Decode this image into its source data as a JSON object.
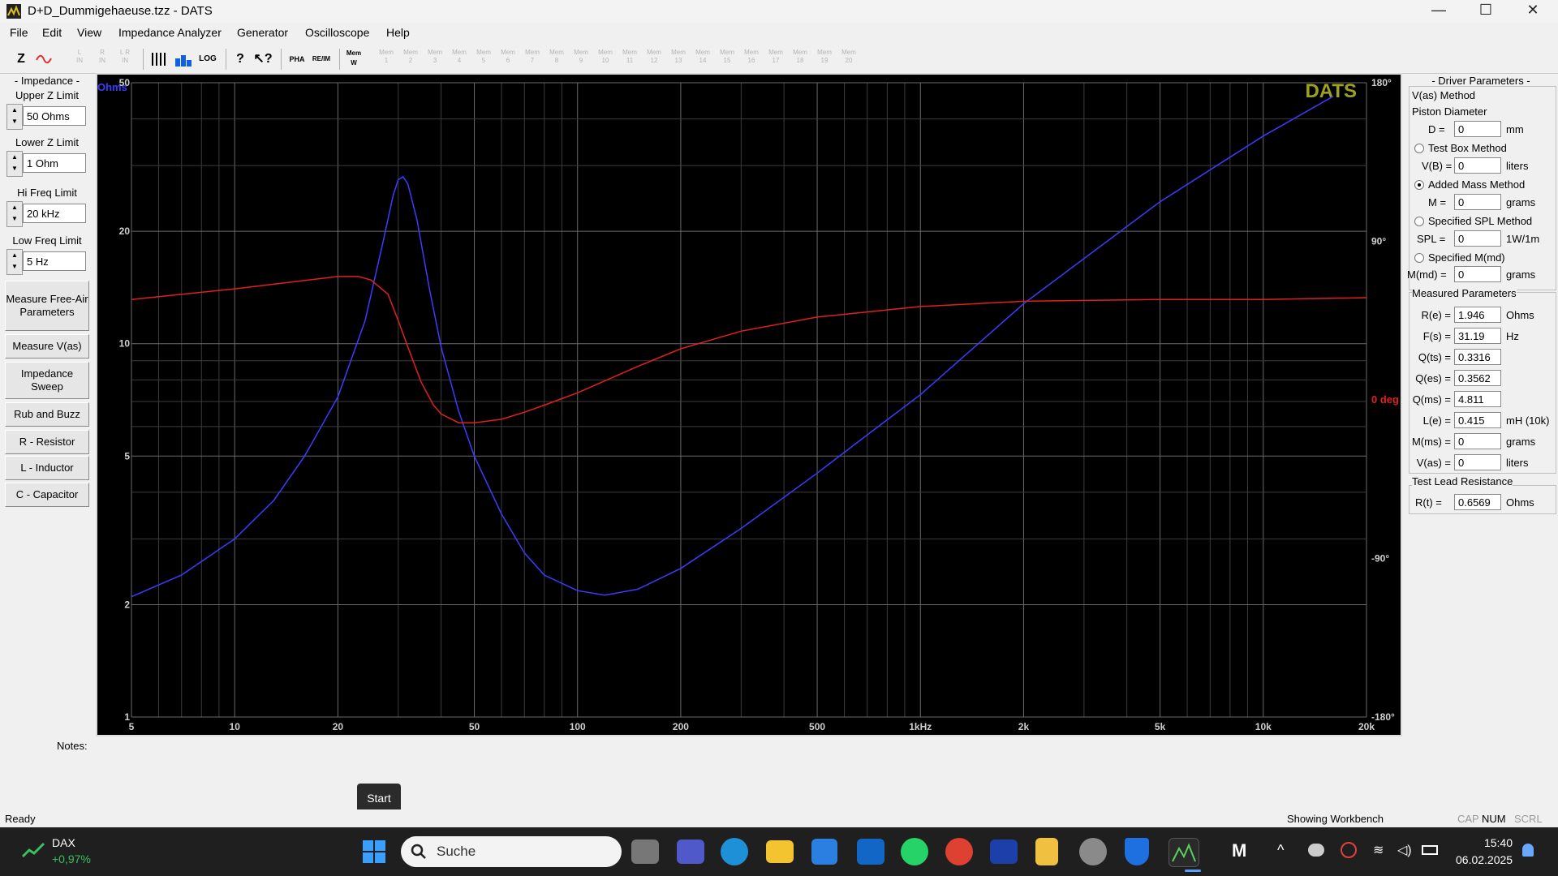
{
  "window": {
    "title": "D+D_Dummigehaeuse.tzz - DATS",
    "minimize": "—",
    "maximize": "☐",
    "close": "✕"
  },
  "menu": [
    "File",
    "Edit",
    "View",
    "Impedance Analyzer",
    "Generator",
    "Oscilloscope",
    "Help"
  ],
  "toolbar": {
    "z_label": "Z",
    "mem_label": "Mem",
    "enabled_tools": [
      "Z",
      "~",
      "ǀǀǀ",
      "▆",
      "LOG",
      "?",
      "?",
      "PHA",
      "RE/IM",
      "Mem W"
    ]
  },
  "left_panel": {
    "impedance_title": "- Impedance -",
    "upper_z_label": "Upper Z Limit",
    "upper_z_value": "50 Ohms",
    "lower_z_label": "Lower Z Limit",
    "lower_z_value": "1 Ohm",
    "hi_freq_label": "Hi Freq Limit",
    "hi_freq_value": "20 kHz",
    "low_freq_label": "Low Freq Limit",
    "low_freq_value": "5 Hz",
    "buttons": [
      "Measure Free-Air Parameters",
      "Measure V(as)",
      "Impedance Sweep",
      "Rub and Buzz",
      "R - Resistor",
      "L - Inductor",
      "C - Capacitor"
    ]
  },
  "plot": {
    "brand": "DATS",
    "y_unit": "Ohms",
    "phase_unit": "0 deg",
    "y_ticks": [
      "50",
      "20",
      "10",
      "5",
      "2",
      "1"
    ],
    "phase_ticks": [
      "180°",
      "90°",
      "-90°",
      "-180°"
    ],
    "x_ticks": [
      "5",
      "10",
      "20",
      "50",
      "100",
      "200",
      "500",
      "1kHz",
      "2k",
      "5k",
      "10k",
      "20k"
    ],
    "colors": {
      "impedance": "#3c3cff",
      "phase": "#e02020",
      "brand": "#a0a020"
    }
  },
  "chart_data": {
    "type": "line",
    "xscale": "log",
    "yscale": "log",
    "xlim": [
      5,
      20000
    ],
    "ylim": [
      1,
      50
    ],
    "y2lim": [
      -180,
      180
    ],
    "x_ticks": [
      "5",
      "10",
      "20",
      "50",
      "100",
      "200",
      "500",
      "1kHz",
      "2k",
      "5k",
      "10k",
      "20k"
    ],
    "y_ticks": [
      "50",
      "20",
      "10",
      "5",
      "2",
      "1"
    ],
    "y2_ticks": [
      "180°",
      "90°",
      "-90°",
      "-180°"
    ],
    "grid": true,
    "series": [
      {
        "axis": "y",
        "color": "#3c3cff",
        "x": [
          5,
          7,
          10,
          13,
          16,
          20,
          24,
          27,
          29,
          30,
          31,
          32,
          34,
          37,
          40,
          45,
          50,
          60,
          70,
          80,
          100,
          120,
          150,
          200,
          300,
          500,
          700,
          1000,
          2000,
          5000,
          10000,
          16000
        ],
        "y": [
          2.1,
          2.4,
          3.0,
          3.8,
          5.0,
          7.2,
          11.5,
          18.5,
          25.0,
          27.5,
          28.0,
          26.8,
          21.5,
          14.0,
          9.8,
          6.6,
          5.0,
          3.5,
          2.75,
          2.4,
          2.18,
          2.12,
          2.2,
          2.5,
          3.2,
          4.5,
          5.7,
          7.3,
          12.8,
          24.0,
          36.0,
          46.0
        ]
      },
      {
        "axis": "y2",
        "color": "#e02020",
        "x": [
          5,
          10,
          20,
          23,
          25,
          28,
          30,
          32,
          35,
          38,
          40,
          45,
          50,
          60,
          70,
          80,
          100,
          150,
          200,
          300,
          500,
          1000,
          2000,
          5000,
          10000,
          20000
        ],
        "y": [
          57,
          63,
          70,
          70,
          68,
          60,
          45,
          30,
          10,
          -3,
          -8,
          -13,
          -13,
          -11,
          -7,
          -3,
          4,
          19,
          29,
          39,
          47,
          53,
          56,
          57,
          57,
          58
        ]
      }
    ]
  },
  "right_panel": {
    "title": "- Driver Parameters -",
    "vas_method": "V(as) Method",
    "piston_diameter": "Piston Diameter",
    "d_label": "D =",
    "d_value": "0",
    "d_unit": "mm",
    "test_box": "Test Box Method",
    "vb_label": "V(B) =",
    "vb_value": "0",
    "vb_unit": "liters",
    "added_mass": "Added Mass Method",
    "m_label": "M =",
    "m_value": "0",
    "m_unit": "grams",
    "spl_method": "Specified SPL Method",
    "spl_label": "SPL =",
    "spl_value": "0",
    "spl_unit": "1W/1m",
    "mmd_method": "Specified M(md)",
    "mmd_label": "M(md) =",
    "mmd_value": "0",
    "mmd_unit": "grams",
    "measured": "Measured Parameters",
    "params": [
      {
        "label": "R(e) =",
        "value": "1.946",
        "unit": "Ohms"
      },
      {
        "label": "F(s) =",
        "value": "31.19",
        "unit": "Hz"
      },
      {
        "label": "Q(ts) =",
        "value": "0.3316",
        "unit": ""
      },
      {
        "label": "Q(es) =",
        "value": "0.3562",
        "unit": ""
      },
      {
        "label": "Q(ms) =",
        "value": "4.811",
        "unit": ""
      },
      {
        "label": "L(e) =",
        "value": "0.415",
        "unit": "mH (10k)"
      },
      {
        "label": "M(ms) =",
        "value": "0",
        "unit": "grams"
      },
      {
        "label": "V(as) =",
        "value": "0",
        "unit": "liters"
      }
    ],
    "test_lead": "Test Lead Resistance",
    "rt_label": "R(t) =",
    "rt_value": "0.6569",
    "rt_unit": "Ohms"
  },
  "notes_label": "Notes:",
  "tooltip": "Start",
  "status": {
    "ready": "Ready",
    "workbench": "Showing Workbench",
    "cap": "CAP",
    "num": "NUM",
    "scrl": "SCRL"
  },
  "taskbar": {
    "dax_name": "DAX",
    "dax_change": "+0,97%",
    "search": "Suche",
    "time": "15:40",
    "date": "06.02.2025"
  }
}
